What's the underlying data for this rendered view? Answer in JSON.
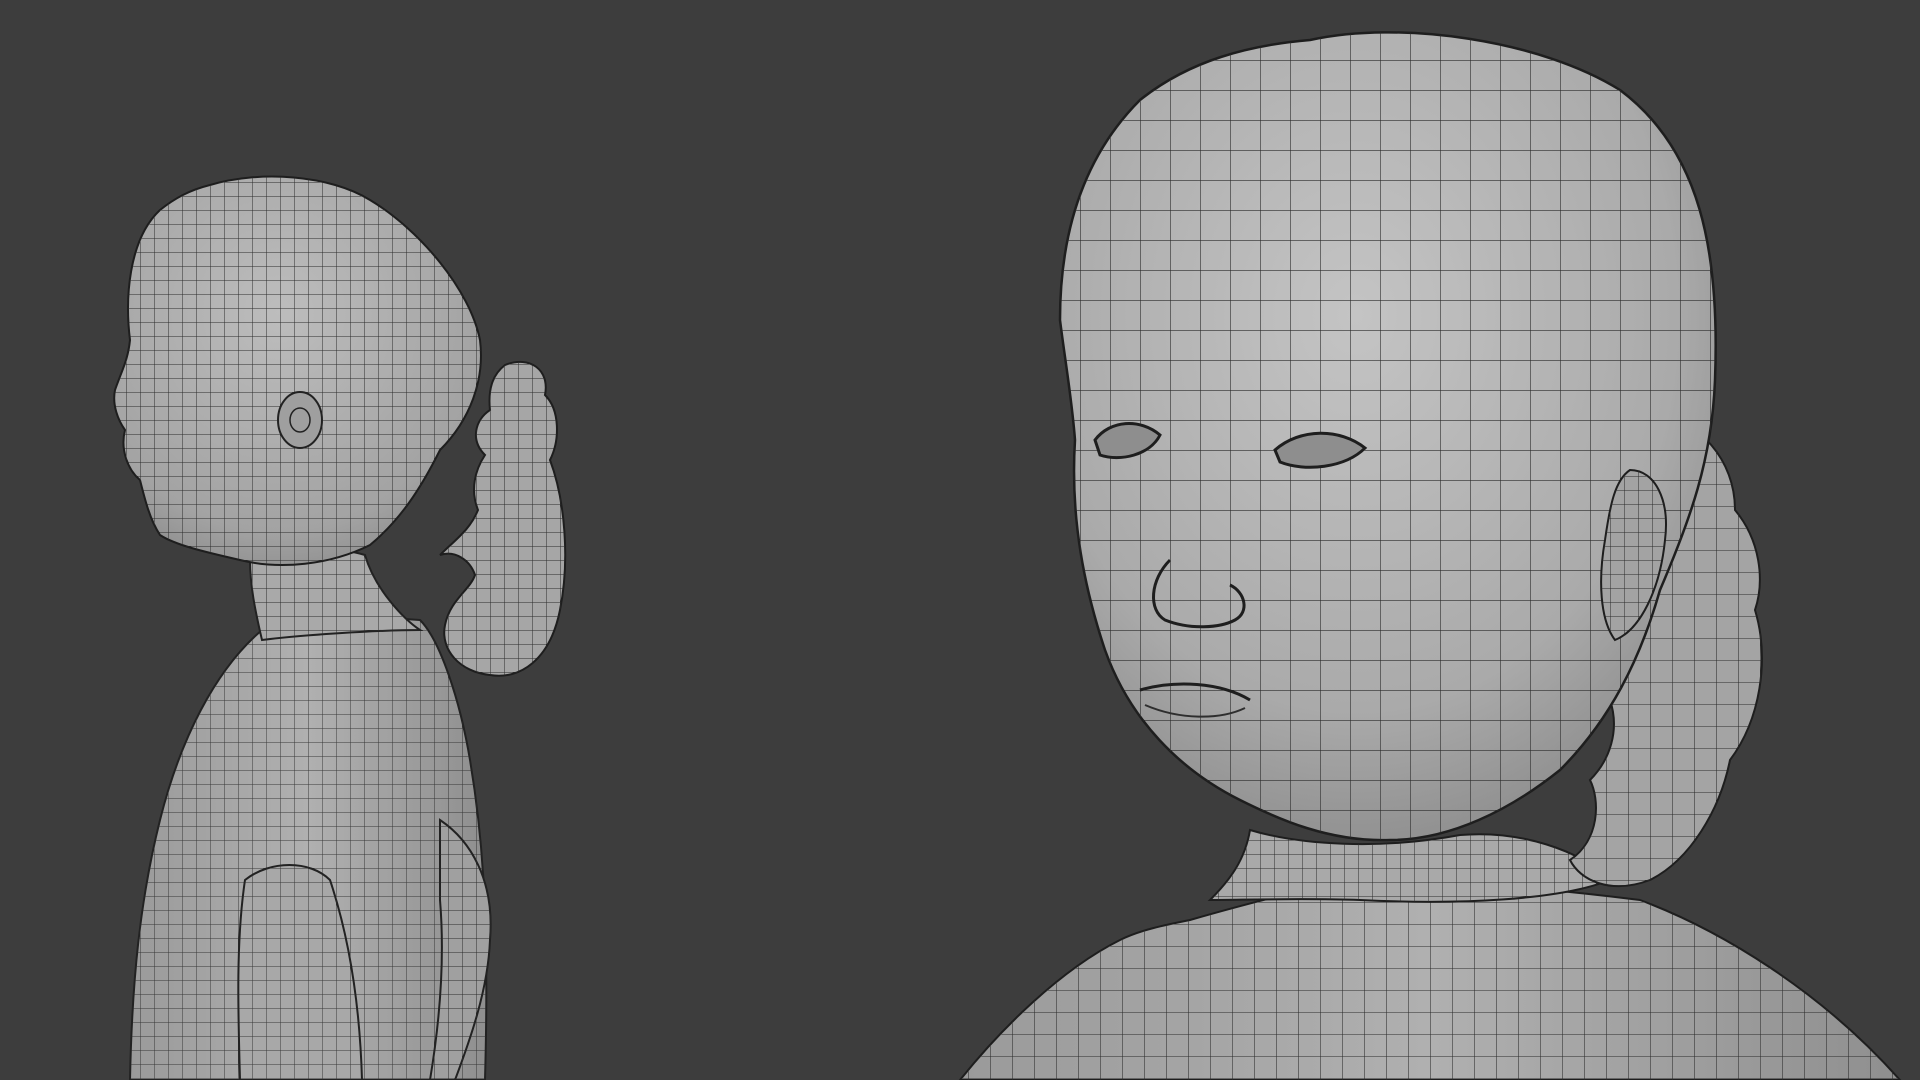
{
  "viewport": {
    "background_color": "#3d3d3d",
    "shading": "solid",
    "overlay": "wireframe"
  },
  "models": [
    {
      "name": "character-side-view",
      "view": "side",
      "base_color": "#a9a9a9",
      "wire_color": "#2a2a2a"
    },
    {
      "name": "character-front-closeup",
      "view": "three-quarter",
      "base_color": "#b4b4b4",
      "wire_color": "#2a2a2a"
    }
  ]
}
